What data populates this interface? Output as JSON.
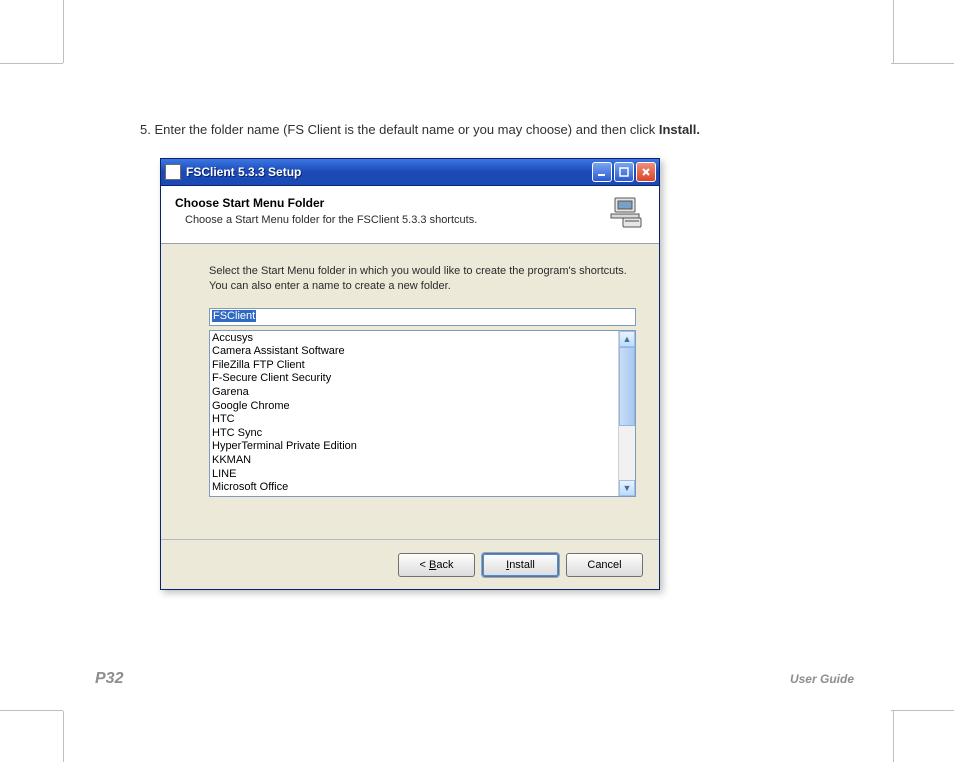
{
  "instruction": {
    "prefix": "5. Enter the folder name (FS Client is the default name or you may choose) and then click ",
    "bold": "Install."
  },
  "window": {
    "title": "FSClient 5.3.3 Setup",
    "header": {
      "title": "Choose Start Menu Folder",
      "subtitle": "Choose a Start Menu folder for the FSClient 5.3.3 shortcuts."
    },
    "body_text": "Select the Start Menu folder in which you would like to create the program's shortcuts. You can also enter a name to create a new folder.",
    "input_value": "FSClient",
    "list": [
      "Accusys",
      "Camera Assistant Software",
      "FileZilla FTP Client",
      "F-Secure Client Security",
      "Garena",
      "Google Chrome",
      "HTC",
      "HTC Sync",
      "HyperTerminal Private Edition",
      "KKMAN",
      "LINE",
      "Microsoft Office"
    ],
    "buttons": {
      "back": "< Back",
      "install": "Install",
      "cancel": "Cancel"
    }
  },
  "footer": {
    "page": "P32",
    "doc": "User Guide"
  }
}
